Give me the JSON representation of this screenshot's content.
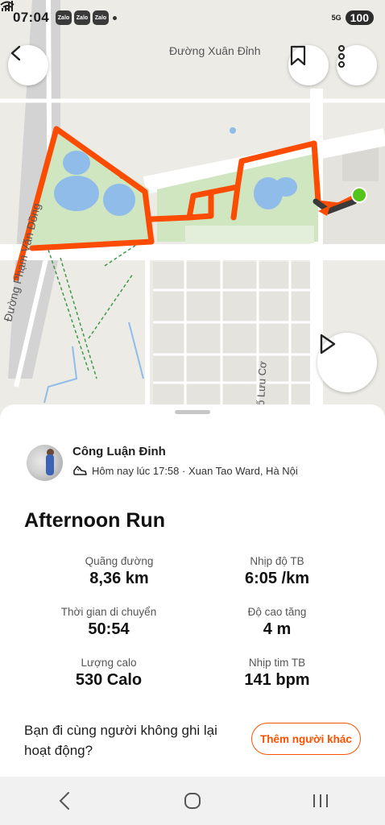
{
  "status_bar": {
    "time": "07:04",
    "notification_icons": [
      "Zalo",
      "Zalo",
      "Zalo"
    ],
    "network": "5G",
    "battery": "100"
  },
  "map": {
    "labels": {
      "street_top": "Đường Xuân Đỉnh",
      "street_left": "Đường Phạm Văn Đồng",
      "street_bottom": "Phố Lưu Cơ"
    },
    "route_color": "#fc4c02",
    "end_marker_color": "#53c41b"
  },
  "activity": {
    "user_name": "Công Luận Đinh",
    "meta": "Hôm nay lúc 17:58 · Xuan Tao Ward, Hà Nội",
    "title": "Afternoon Run",
    "stats": [
      {
        "label": "Quãng đường",
        "value": "8,36 km"
      },
      {
        "label": "Nhịp độ TB",
        "value": "6:05 /km"
      },
      {
        "label": "Thời gian di chuyển",
        "value": "50:54"
      },
      {
        "label": "Độ cao tăng",
        "value": "4 m"
      },
      {
        "label": "Lượng calo",
        "value": "530 Calo"
      },
      {
        "label": "Nhịp tim TB",
        "value": "141 bpm"
      }
    ],
    "question": "Bạn đi cùng người không ghi lại hoạt động?",
    "add_button": "Thêm người khác"
  },
  "colors": {
    "accent": "#fc5200"
  }
}
